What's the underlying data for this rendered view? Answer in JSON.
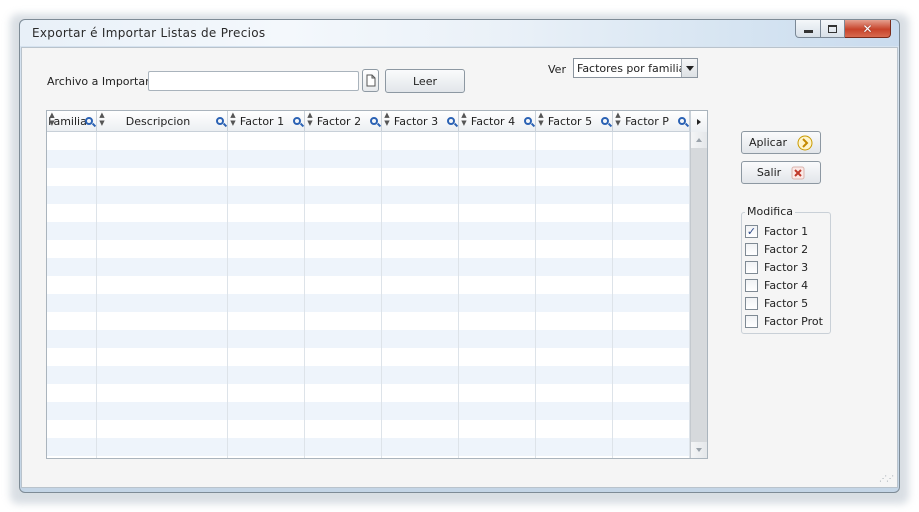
{
  "window": {
    "title": "Exportar é Importar Listas de Precios",
    "close_glyph": "✕"
  },
  "import": {
    "label": "Archivo a Importar",
    "value": "",
    "placeholder": "",
    "browse_icon": "document-icon",
    "read_button": "Leer"
  },
  "view": {
    "label": "Ver",
    "selected": "Factores por familia"
  },
  "grid": {
    "columns": [
      {
        "label": "Familia"
      },
      {
        "label": "Descripcion"
      },
      {
        "label": "Factor 1"
      },
      {
        "label": "Factor 2"
      },
      {
        "label": "Factor 3"
      },
      {
        "label": "Factor 4"
      },
      {
        "label": "Factor 5"
      },
      {
        "label": "Factor P"
      }
    ],
    "sort_glyph": "▲▼",
    "rows": []
  },
  "actions": {
    "apply": "Aplicar",
    "exit": "Salir",
    "apply_color": "#d9a400",
    "exit_color": "#c0392b"
  },
  "modifica": {
    "legend": "Modifica",
    "options": [
      {
        "label": "Factor 1",
        "checked": true,
        "mark": "✓"
      },
      {
        "label": "Factor 2",
        "checked": false,
        "mark": ""
      },
      {
        "label": "Factor 3",
        "checked": false,
        "mark": ""
      },
      {
        "label": "Factor 4",
        "checked": false,
        "mark": ""
      },
      {
        "label": "Factor 5",
        "checked": false,
        "mark": ""
      },
      {
        "label": "Factor Prot",
        "checked": false,
        "mark": ""
      }
    ]
  }
}
